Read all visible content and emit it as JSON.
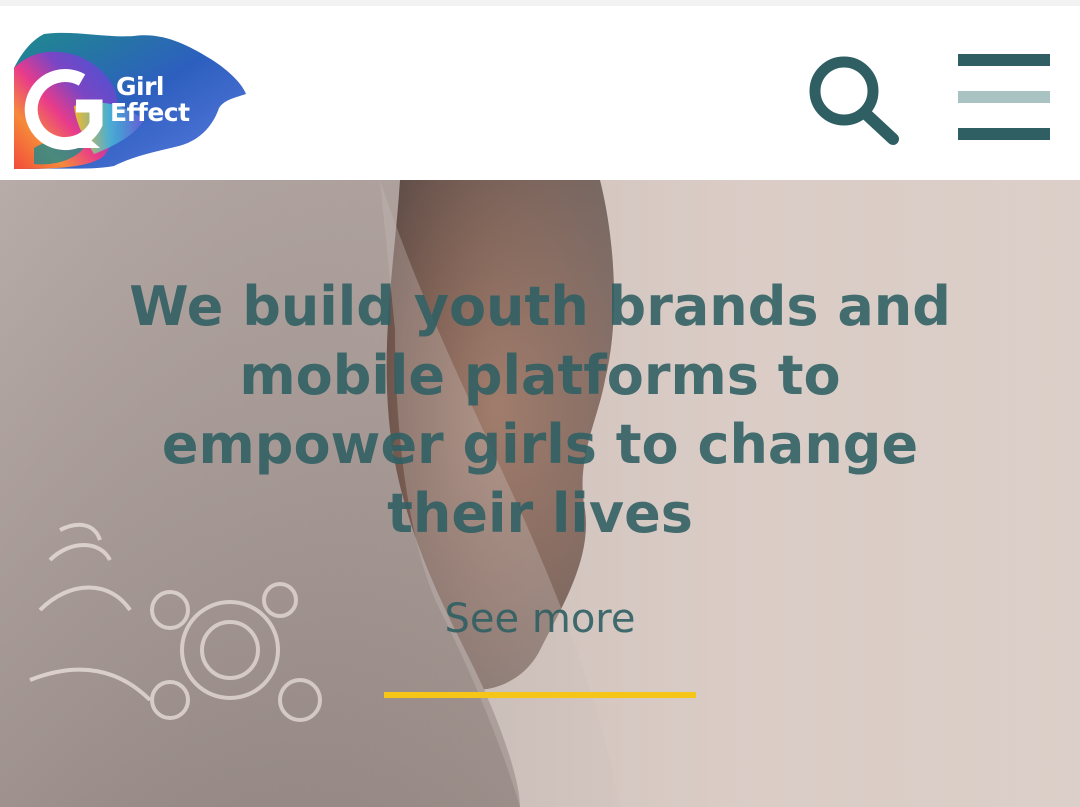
{
  "header": {
    "logo": {
      "line1": "Girl",
      "line2": "Effect"
    },
    "search_icon": "search-icon",
    "menu_icon": "hamburger-menu-icon"
  },
  "hero": {
    "headline": "We build youth brands and mobile platforms to empower girls to change their lives",
    "cta_label": "See more"
  },
  "colors": {
    "brand_teal": "#2f5f63",
    "menu_middle_bar": "#a9c3c2",
    "accent_yellow": "#f5c518",
    "header_bg": "#ffffff"
  }
}
